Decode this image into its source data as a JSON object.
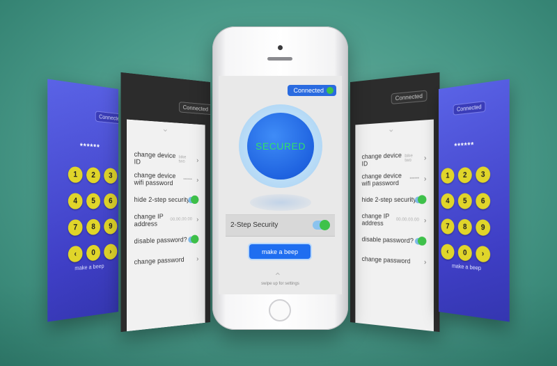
{
  "main": {
    "connected_label": "Connected",
    "status_text": "SECURED",
    "two_step_label": "2-Step Security",
    "two_step_enabled": true,
    "beep_label": "make a beep",
    "swipe_hint": "swipe up for settings"
  },
  "settings": {
    "connected_label": "Connected",
    "items": [
      {
        "label": "change device ID",
        "value": "bike two"
      },
      {
        "label": "change device wifi password",
        "value": "••••••"
      },
      {
        "label": "hide 2-step security",
        "value": ""
      },
      {
        "label": "change IP address",
        "value": "00.00.00.00"
      },
      {
        "label": "disable password?",
        "value": ""
      },
      {
        "label": "change password",
        "value": ""
      }
    ]
  },
  "keypad": {
    "connected_label": "Connected",
    "password_mask": "******",
    "keys": [
      "1",
      "2",
      "3",
      "4",
      "5",
      "6",
      "7",
      "8",
      "9",
      "‹",
      "0",
      "›"
    ],
    "beep_label": "make a beep"
  },
  "colors": {
    "background": "#4a9a89",
    "accent_blue": "#1f6ef0",
    "status_green": "#31e06a",
    "key_yellow": "#e0d52a",
    "keypad_bg": "#4343c9"
  }
}
